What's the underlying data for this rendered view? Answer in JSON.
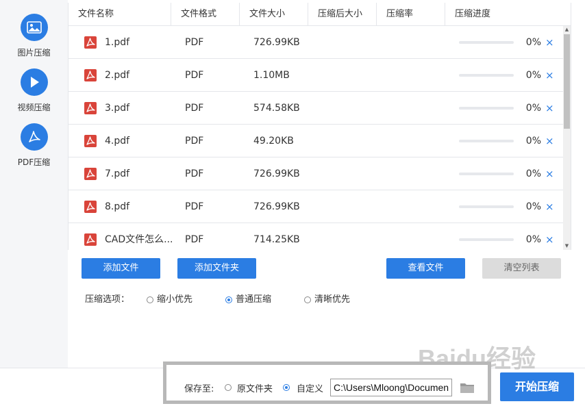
{
  "colors": {
    "accent": "#2b7de3",
    "pdf_red": "#d9443a",
    "gray_button": "#dcdcdc"
  },
  "nav": {
    "items": [
      {
        "label": "图片压缩",
        "icon": "image-icon"
      },
      {
        "label": "视频压缩",
        "icon": "play-icon"
      },
      {
        "label": "PDF压缩",
        "icon": "pdf-acrobat-icon",
        "active": true
      }
    ]
  },
  "table": {
    "headers": [
      "文件名称",
      "文件格式",
      "文件大小",
      "压缩后大小",
      "压缩率",
      "压缩进度"
    ],
    "rows": [
      {
        "name": "1.pdf",
        "format": "PDF",
        "size": "726.99KB",
        "progress": "0%",
        "progress_value": 0
      },
      {
        "name": "2.pdf",
        "format": "PDF",
        "size": "1.10MB",
        "progress": "0%",
        "progress_value": 0
      },
      {
        "name": "3.pdf",
        "format": "PDF",
        "size": "574.58KB",
        "progress": "0%",
        "progress_value": 0
      },
      {
        "name": "4.pdf",
        "format": "PDF",
        "size": "49.20KB",
        "progress": "0%",
        "progress_value": 0
      },
      {
        "name": "7.pdf",
        "format": "PDF",
        "size": "726.99KB",
        "progress": "0%",
        "progress_value": 0
      },
      {
        "name": "8.pdf",
        "format": "PDF",
        "size": "726.99KB",
        "progress": "0%",
        "progress_value": 0
      },
      {
        "name": "CAD文件怎么...",
        "format": "PDF",
        "size": "714.25KB",
        "progress": "0%",
        "progress_value": 0
      }
    ],
    "remove_icon": "×"
  },
  "buttons": {
    "add_file": "添加文件",
    "add_folder": "添加文件夹",
    "view_files": "查看文件",
    "clear_list": "清空列表",
    "start": "开始压缩"
  },
  "compression_options": {
    "title": "压缩选项：",
    "options": [
      {
        "label": "缩小优先",
        "selected": false
      },
      {
        "label": "普通压缩",
        "selected": true
      },
      {
        "label": "清晰优先",
        "selected": false
      }
    ]
  },
  "save": {
    "label": "保存至:",
    "options": [
      {
        "label": "原文件夹",
        "selected": false
      },
      {
        "label": "自定义",
        "selected": true
      }
    ],
    "path": "C:\\Users\\Mloong\\Documents",
    "folder_icon": "folder-icon"
  },
  "watermark": "Baidu经验"
}
